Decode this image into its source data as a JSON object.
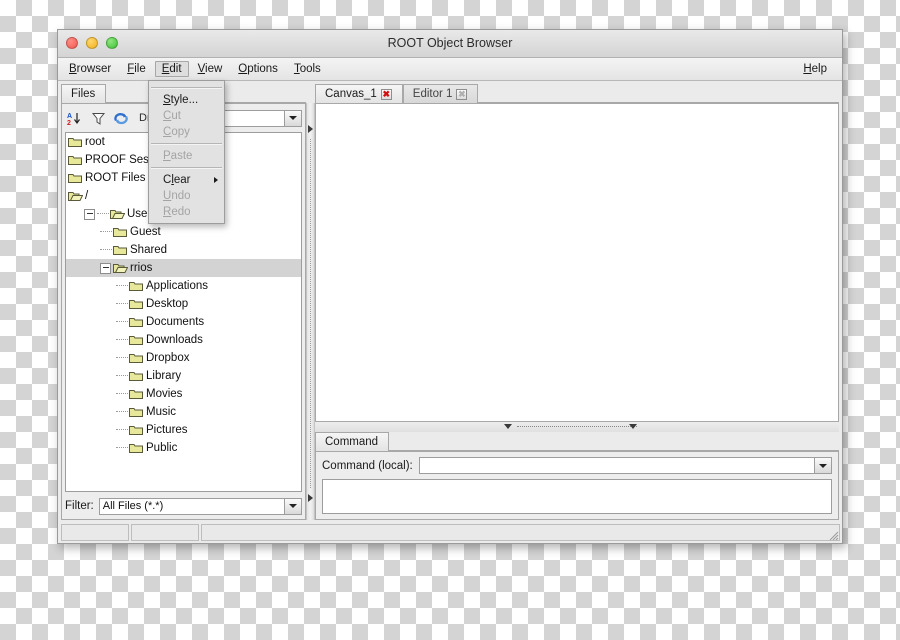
{
  "window": {
    "title": "ROOT Object Browser",
    "traffic_lights": [
      "close-button",
      "minimize-button",
      "zoom-button"
    ]
  },
  "menubar": {
    "items": [
      {
        "label": "Browser",
        "mnemonic": "B",
        "active": false
      },
      {
        "label": "File",
        "mnemonic": "F",
        "active": false
      },
      {
        "label": "Edit",
        "mnemonic": "E",
        "active": true
      },
      {
        "label": "View",
        "mnemonic": "V",
        "active": false
      },
      {
        "label": "Options",
        "mnemonic": "O",
        "active": false
      },
      {
        "label": "Tools",
        "mnemonic": "T",
        "active": false
      }
    ],
    "help": {
      "label": "Help",
      "mnemonic": "H"
    }
  },
  "edit_menu": {
    "items": [
      {
        "label": "Style...",
        "mnemonic": "S",
        "disabled": false,
        "submenu": false
      },
      {
        "label": "Cut",
        "mnemonic": "C",
        "disabled": true,
        "submenu": false
      },
      {
        "label": "Copy",
        "mnemonic": "C",
        "disabled": true,
        "submenu": false
      },
      {
        "label": "Paste",
        "mnemonic": "P",
        "disabled": true,
        "submenu": false
      },
      {
        "label": "Clear",
        "mnemonic": "l",
        "disabled": false,
        "submenu": true
      },
      {
        "label": "Undo",
        "mnemonic": "U",
        "disabled": true,
        "submenu": false
      },
      {
        "label": "Redo",
        "mnemonic": "R",
        "disabled": true,
        "submenu": false
      }
    ]
  },
  "left_pane": {
    "tab_label": "Files",
    "toolbar": {
      "sort_icon": "sort-az-icon",
      "filter_icon": "funnel-icon",
      "refresh_icon": "refresh-icon",
      "draw_option_label": "Draw Option:",
      "draw_option_value": ""
    },
    "tree": [
      {
        "label": "root",
        "depth": 0,
        "expander": "none",
        "folder": "closed",
        "selected": false,
        "dash": false
      },
      {
        "label": "PROOF Sessions",
        "depth": 0,
        "expander": "none",
        "folder": "closed",
        "selected": false,
        "dash": false
      },
      {
        "label": "ROOT Files",
        "depth": 0,
        "expander": "none",
        "folder": "closed",
        "selected": false,
        "dash": false
      },
      {
        "label": "/",
        "depth": 0,
        "expander": "none",
        "folder": "open",
        "selected": false,
        "dash": false
      },
      {
        "label": "Users",
        "depth": 1,
        "expander": "minus",
        "folder": "open",
        "selected": false,
        "dash": true
      },
      {
        "label": "Guest",
        "depth": 2,
        "expander": "none",
        "folder": "closed",
        "selected": false,
        "dash": true
      },
      {
        "label": "Shared",
        "depth": 2,
        "expander": "none",
        "folder": "closed",
        "selected": false,
        "dash": true
      },
      {
        "label": "rrios",
        "depth": 2,
        "expander": "minus",
        "folder": "open",
        "selected": true,
        "dash": false
      },
      {
        "label": "Applications",
        "depth": 3,
        "expander": "none",
        "folder": "closed",
        "selected": false,
        "dash": true
      },
      {
        "label": "Desktop",
        "depth": 3,
        "expander": "none",
        "folder": "closed",
        "selected": false,
        "dash": true
      },
      {
        "label": "Documents",
        "depth": 3,
        "expander": "none",
        "folder": "closed",
        "selected": false,
        "dash": true
      },
      {
        "label": "Downloads",
        "depth": 3,
        "expander": "none",
        "folder": "closed",
        "selected": false,
        "dash": true
      },
      {
        "label": "Dropbox",
        "depth": 3,
        "expander": "none",
        "folder": "closed",
        "selected": false,
        "dash": true
      },
      {
        "label": "Library",
        "depth": 3,
        "expander": "none",
        "folder": "closed",
        "selected": false,
        "dash": true
      },
      {
        "label": "Movies",
        "depth": 3,
        "expander": "none",
        "folder": "closed",
        "selected": false,
        "dash": true
      },
      {
        "label": "Music",
        "depth": 3,
        "expander": "none",
        "folder": "closed",
        "selected": false,
        "dash": true
      },
      {
        "label": "Pictures",
        "depth": 3,
        "expander": "none",
        "folder": "closed",
        "selected": false,
        "dash": true
      },
      {
        "label": "Public",
        "depth": 3,
        "expander": "none",
        "folder": "closed",
        "selected": false,
        "dash": true
      }
    ],
    "filter": {
      "label": "Filter:",
      "value": "All Files (*.*)"
    }
  },
  "right_pane": {
    "tabs": [
      {
        "label": "Canvas_1",
        "active": true,
        "close_icon": "close-icon",
        "close_enabled": true
      },
      {
        "label": "Editor 1",
        "active": false,
        "close_icon": "close-icon",
        "close_enabled": false
      }
    ],
    "canvas_content": "",
    "command_panel": {
      "tab_label": "Command",
      "input_label": "Command (local):",
      "input_value": "",
      "output_value": ""
    }
  },
  "statusbar": {
    "cells": [
      "",
      "",
      ""
    ],
    "grip_icon": "resize-grip-icon"
  },
  "colors": {
    "window_bg": "#ebebeb",
    "panel_bg": "#ededed",
    "selection": "#d3d3d3",
    "folder_fill": "#e8e89a",
    "close_red": "#d01010",
    "titlebar_top": "#e9e9e9"
  }
}
